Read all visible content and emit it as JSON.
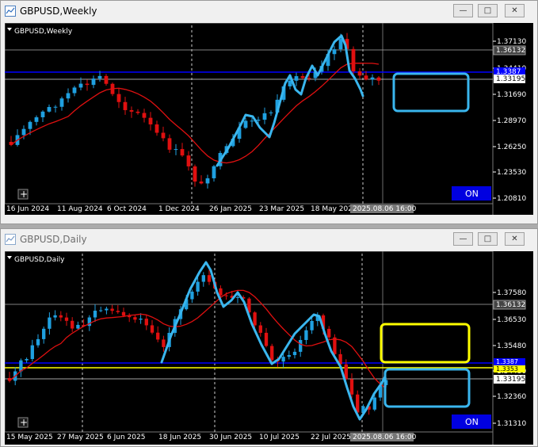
{
  "colors": {
    "background": "#000000",
    "bull": "#1fa0e0",
    "bear": "#e01010",
    "ma": "#e01010",
    "drawing": "#3ab6ee",
    "h_blue": "#0000ff",
    "h_yellow": "#ffff00",
    "grid": "#ffffff",
    "on_badge": "#0000e0"
  },
  "windows": [
    {
      "title": "GBPUSD,Weekly",
      "chart_label": "GBPUSD,Weekly",
      "price_ticks": [
        "1.37130",
        "1.34410",
        "1.31690",
        "1.28970",
        "1.26250",
        "1.23530",
        "1.20810"
      ],
      "price_tags": [
        {
          "text": "1.36132",
          "style": "grey"
        },
        {
          "text": "1.33195",
          "style": "white"
        },
        {
          "text": "1.3387",
          "style": "blue"
        }
      ],
      "time_labels": [
        "16 Jun 2024",
        "11 Aug 2024",
        "6 Oct 2024",
        "1 Dec 2024",
        "26 Jan 2025",
        "23 Mar 2025",
        "18 May 2025"
      ],
      "crosshair_time": "2025.08.06 16:00",
      "on_label": "ON",
      "plus_label": "+"
    },
    {
      "title": "GBPUSD,Daily",
      "chart_label": "GBPUSD,Daily",
      "price_ticks": [
        "1.37580",
        "1.36530",
        "1.35480",
        "1.34430",
        "1.33380",
        "1.32360",
        "1.31310"
      ],
      "price_tags": [
        {
          "text": "1.36132",
          "style": "grey"
        },
        {
          "text": "1.33195",
          "style": "white"
        },
        {
          "text": "1.3387",
          "style": "blue"
        },
        {
          "text": "1.3353",
          "style": "yellow"
        }
      ],
      "time_labels": [
        "15 May 2025",
        "27 May 2025",
        "6 Jun 2025",
        "18 Jun 2025",
        "30 Jun 2025",
        "10 Jul 2025",
        "22 Jul 2025"
      ],
      "crosshair_time": "2025.08.06 16:00",
      "on_label": "ON",
      "plus_label": "+"
    }
  ]
}
